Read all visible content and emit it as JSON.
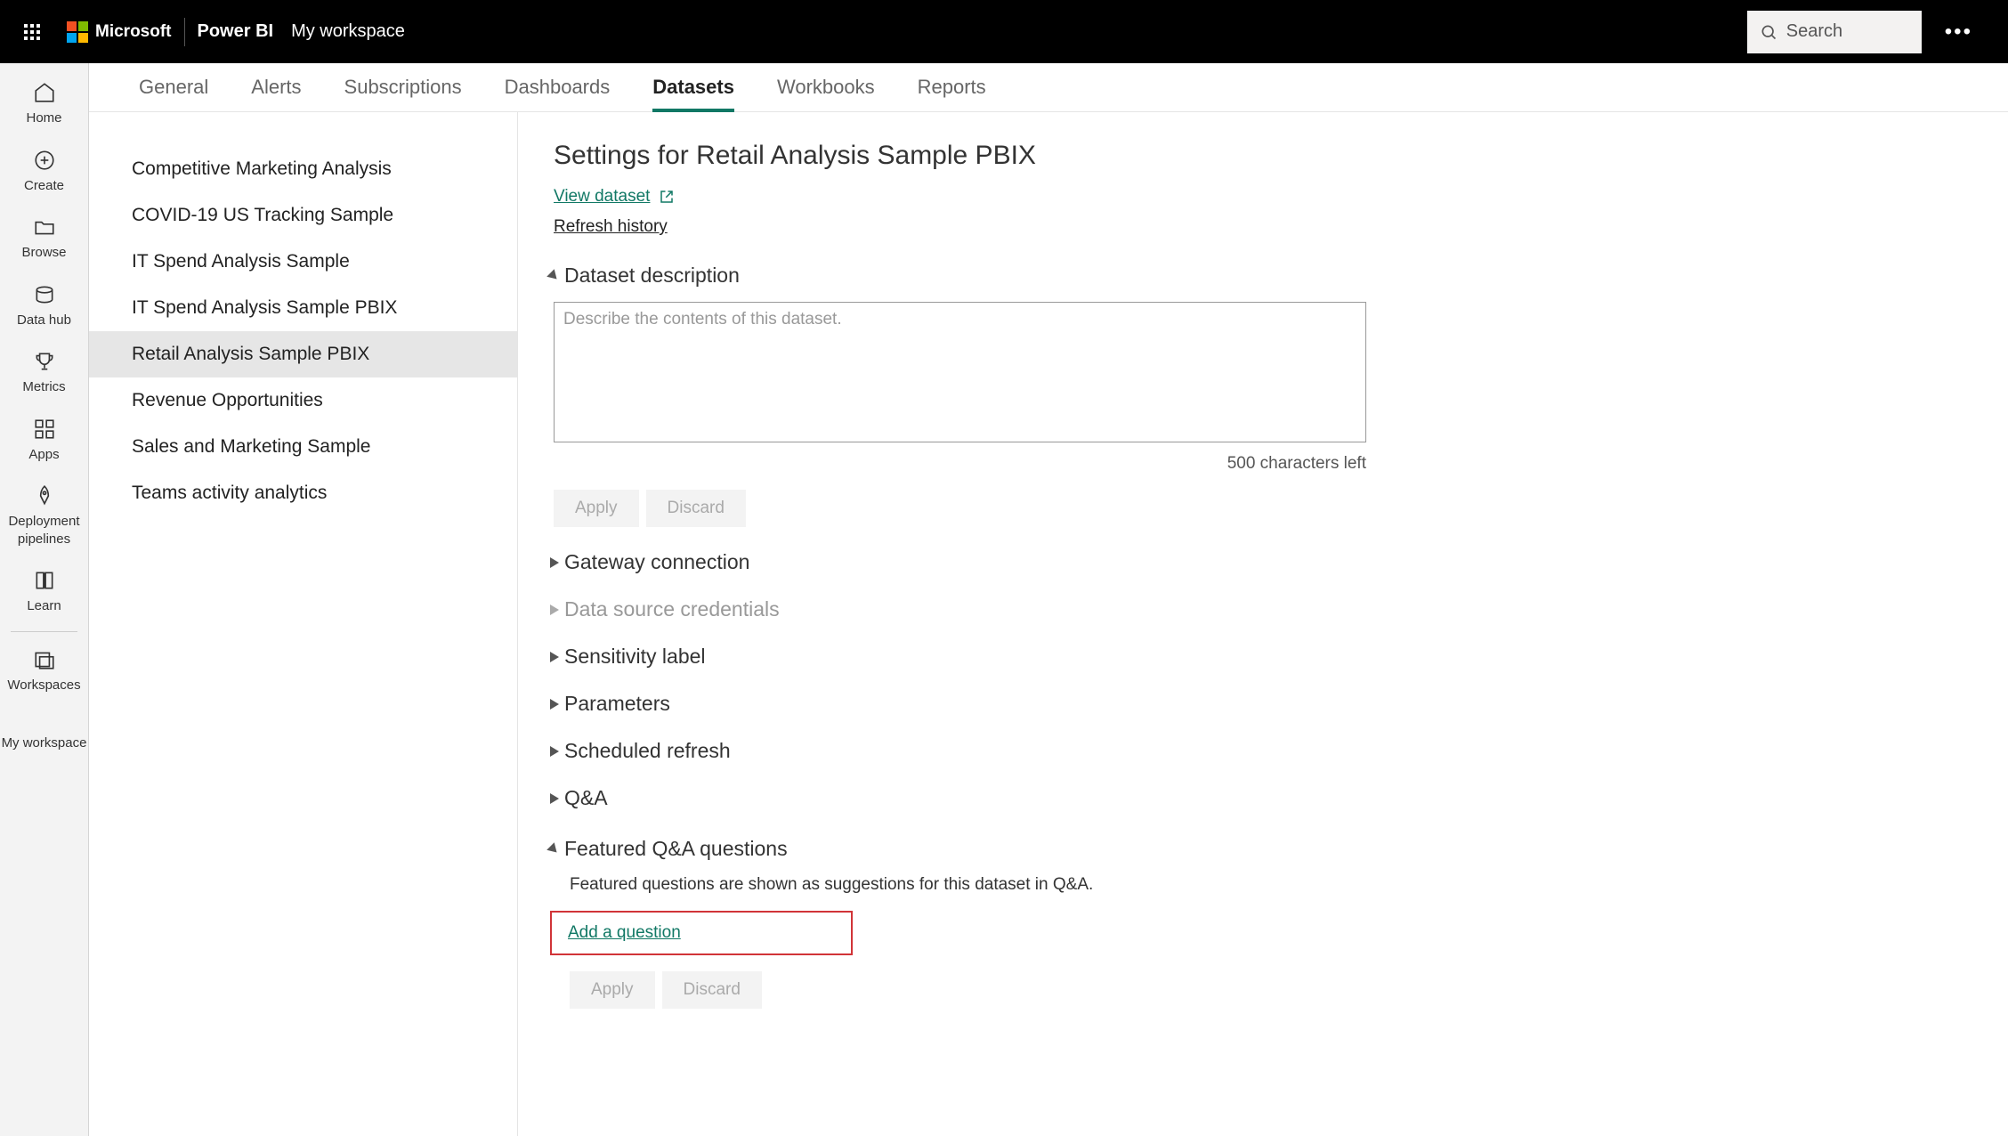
{
  "header": {
    "microsoft": "Microsoft",
    "product": "Power BI",
    "breadcrumb": "My workspace",
    "search_placeholder": "Search"
  },
  "leftNav": {
    "items": [
      {
        "label": "Home"
      },
      {
        "label": "Create"
      },
      {
        "label": "Browse"
      },
      {
        "label": "Data hub"
      },
      {
        "label": "Metrics"
      },
      {
        "label": "Apps"
      },
      {
        "label": "Deployment pipelines"
      },
      {
        "label": "Learn"
      },
      {
        "label": "Workspaces"
      },
      {
        "label": "My workspace"
      }
    ]
  },
  "tabs": [
    {
      "label": "General"
    },
    {
      "label": "Alerts"
    },
    {
      "label": "Subscriptions"
    },
    {
      "label": "Dashboards"
    },
    {
      "label": "Datasets"
    },
    {
      "label": "Workbooks"
    },
    {
      "label": "Reports"
    }
  ],
  "datasetList": [
    "Competitive Marketing Analysis",
    "COVID-19 US Tracking Sample",
    "IT Spend Analysis Sample",
    "IT Spend Analysis Sample PBIX",
    "Retail Analysis Sample PBIX",
    "Revenue Opportunities",
    "Sales and Marketing Sample",
    "Teams activity analytics"
  ],
  "settings": {
    "title": "Settings for Retail Analysis Sample PBIX",
    "view_dataset": "View dataset",
    "refresh_history": "Refresh history",
    "sections": {
      "description": {
        "title": "Dataset description",
        "placeholder": "Describe the contents of this dataset.",
        "char_counter": "500 characters left",
        "apply": "Apply",
        "discard": "Discard"
      },
      "gateway": "Gateway connection",
      "credentials": "Data source credentials",
      "sensitivity": "Sensitivity label",
      "parameters": "Parameters",
      "scheduled": "Scheduled refresh",
      "qa": "Q&A",
      "featured": {
        "title": "Featured Q&A questions",
        "desc": "Featured questions are shown as suggestions for this dataset in Q&A.",
        "add": "Add a question",
        "apply": "Apply",
        "discard": "Discard"
      }
    }
  }
}
